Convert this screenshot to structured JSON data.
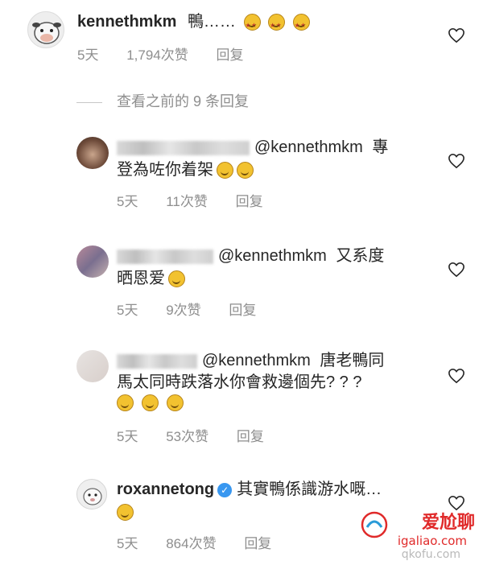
{
  "top_comment": {
    "username": "kennethmkm",
    "text": "鴨……",
    "time": "5天",
    "likes": "1,794次赞",
    "reply": "回复"
  },
  "view_previous": "查看之前的 9 条回复",
  "replies": [
    {
      "mention": "@kennethmkm",
      "text_line1": "專",
      "text_line2": "登為咗你着架",
      "time": "5天",
      "likes": "11次赞",
      "reply": "回复"
    },
    {
      "mention": "@kennethmkm",
      "text_line1": "又系度",
      "text_line2": "晒恩爱",
      "time": "5天",
      "likes": "9次赞",
      "reply": "回复"
    },
    {
      "mention": "@kennethmkm",
      "text_line1": "唐老鴨同",
      "text_line2": "馬太同時跌落水你會救邊個先? ? ?",
      "time": "5天",
      "likes": "53次赞",
      "reply": "回复"
    },
    {
      "username": "roxannetong",
      "text_line1": "其實鴨係識游水嘅…",
      "time": "5天",
      "likes": "864次赞",
      "reply": "回复"
    }
  ],
  "watermark": {
    "brand": "爱尬聊",
    "site": "igaliao.com",
    "site2": "qkofu.com"
  },
  "icons": [
    "heart-outline-icon",
    "verified-badge-icon",
    "emoji-icon"
  ],
  "colors": {
    "text": "#262626",
    "meta": "#8e8e8e",
    "verified": "#3897f0",
    "watermark": "#e02a2a"
  }
}
